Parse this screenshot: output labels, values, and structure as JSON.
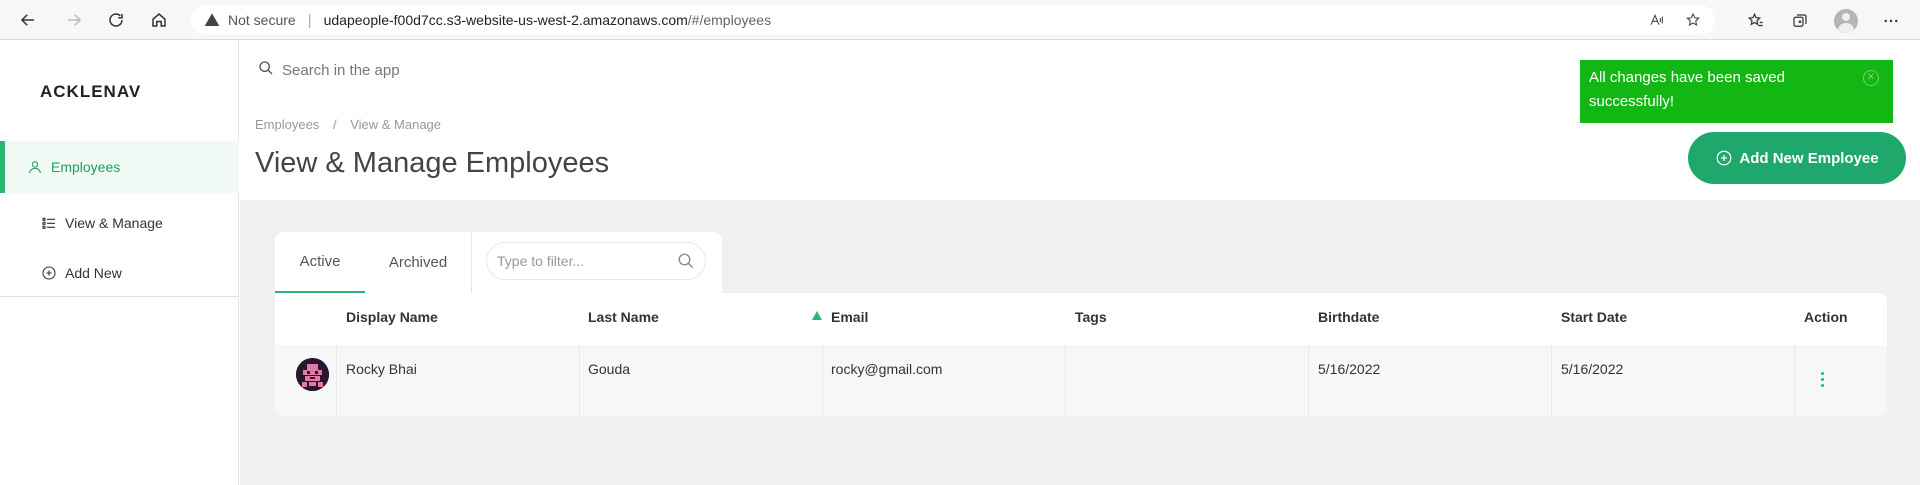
{
  "browser": {
    "not_secure": "Not secure",
    "url_host": "udapeople-f00d7cc.s3-website-us-west-2.amazonaws.com",
    "url_path": "/#/employees"
  },
  "sidebar": {
    "logo": "ACKLENAVENUE",
    "items": [
      {
        "label": "Employees",
        "icon": "user-icon",
        "active": true
      },
      {
        "label": "View & Manage",
        "icon": "list-icon",
        "active": false
      },
      {
        "label": "Add New",
        "icon": "plus-circle-icon",
        "active": false
      }
    ]
  },
  "header": {
    "search_placeholder": "Search in the app",
    "breadcrumb": [
      "Employees",
      "View & Manage"
    ],
    "breadcrumb_sep": "/",
    "title": "View & Manage Employees",
    "add_button": "Add New Employee"
  },
  "toast": {
    "message": "All changes have been saved successfully!",
    "color": "#13b713"
  },
  "tabs": {
    "active": "Active",
    "archived": "Archived",
    "filter_placeholder": "Type to filter..."
  },
  "table": {
    "columns": [
      "Display Name",
      "Last Name",
      "Email",
      "Tags",
      "Birthdate",
      "Start Date",
      "Action"
    ],
    "sorted_column": "Email",
    "rows": [
      {
        "display_name": "Rocky Bhai",
        "last_name": "Gouda",
        "email": "rocky@gmail.com",
        "tags": "",
        "birthdate": "5/16/2022",
        "start_date": "5/16/2022"
      }
    ]
  },
  "colors": {
    "accent": "#2bb673",
    "button": "#1fa86b"
  }
}
